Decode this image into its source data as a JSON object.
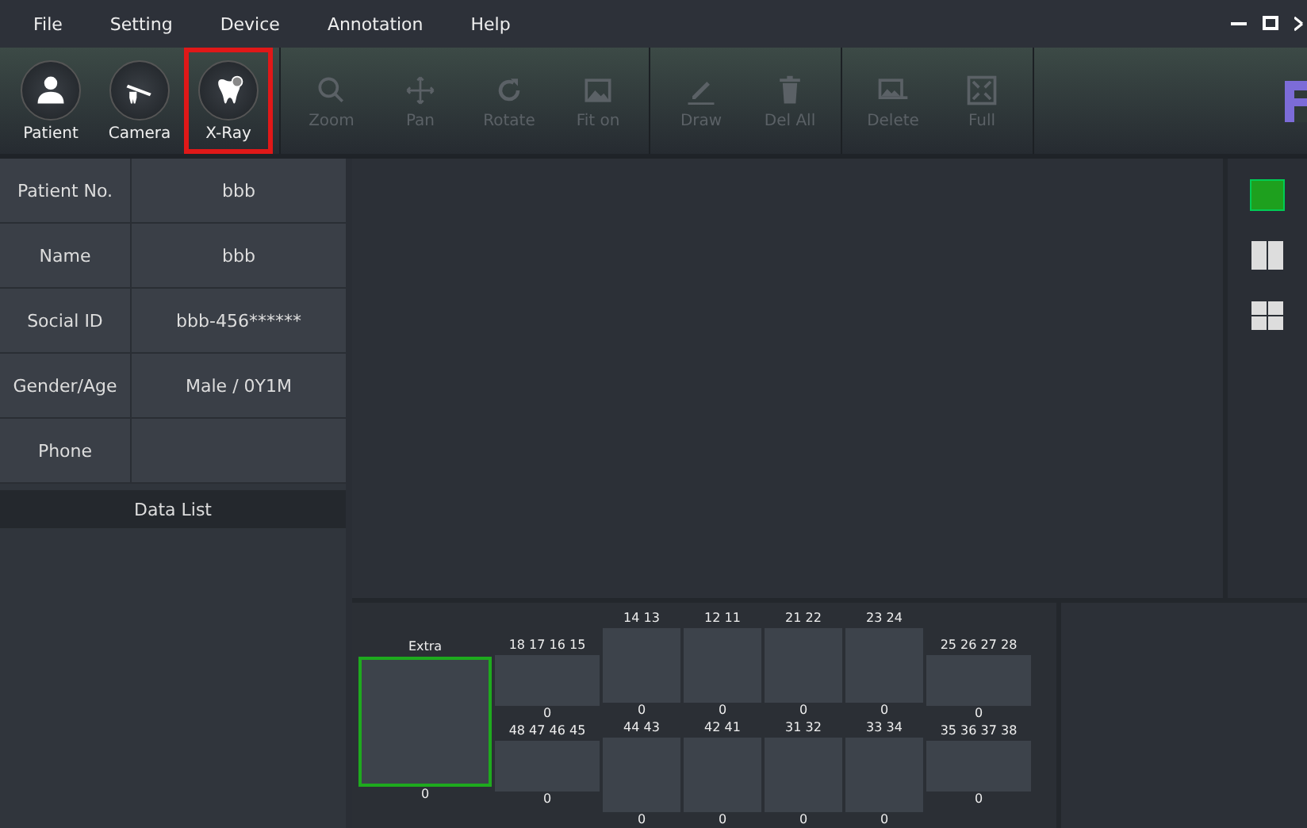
{
  "menu": [
    "File",
    "Setting",
    "Device",
    "Annotation",
    "Help"
  ],
  "toolbar": {
    "groups": [
      [
        {
          "label": "Patient",
          "kind": "person",
          "disabled": false,
          "highlighted": false
        },
        {
          "label": "Camera",
          "kind": "camera",
          "disabled": false,
          "highlighted": false
        },
        {
          "label": "X-Ray",
          "kind": "tooth",
          "disabled": false,
          "highlighted": true
        }
      ],
      [
        {
          "label": "Zoom",
          "kind": "zoom",
          "disabled": true,
          "highlighted": false
        },
        {
          "label": "Pan",
          "kind": "pan",
          "disabled": true,
          "highlighted": false
        },
        {
          "label": "Rotate",
          "kind": "rotate",
          "disabled": true,
          "highlighted": false
        },
        {
          "label": "Fit on",
          "kind": "fit",
          "disabled": true,
          "highlighted": false
        }
      ],
      [
        {
          "label": "Draw",
          "kind": "draw",
          "disabled": true,
          "highlighted": false
        },
        {
          "label": "Del All",
          "kind": "trash",
          "disabled": true,
          "highlighted": false
        }
      ],
      [
        {
          "label": "Delete",
          "kind": "image",
          "disabled": true,
          "highlighted": false
        },
        {
          "label": "Full",
          "kind": "full",
          "disabled": true,
          "highlighted": false
        }
      ]
    ]
  },
  "patient": [
    {
      "label": "Patient No.",
      "value": "bbb"
    },
    {
      "label": "Name",
      "value": "bbb"
    },
    {
      "label": "Social ID",
      "value": "bbb-456******"
    },
    {
      "label": "Gender/Age",
      "value": "Male / 0Y1M"
    },
    {
      "label": "Phone"
    }
  ],
  "data_list": {
    "title": "Data List"
  },
  "layouts": [
    {
      "kind": "single",
      "selected": true
    },
    {
      "kind": "two",
      "selected": false
    },
    {
      "kind": "four",
      "selected": false
    }
  ],
  "tooth_chart": {
    "extra": {
      "label": "Extra",
      "count": "0",
      "selected": true
    },
    "columns": [
      {
        "kind": "side",
        "upper": {
          "label": "18 17 16 15",
          "count": "0"
        },
        "lower": {
          "label": "48 47 46 45",
          "count": "0"
        }
      },
      {
        "kind": "center",
        "upper": {
          "label": "14 13",
          "count": "0"
        },
        "lower": {
          "label": "44 43",
          "count": "0"
        }
      },
      {
        "kind": "center",
        "upper": {
          "label": "12 11",
          "count": "0"
        },
        "lower": {
          "label": "42 41",
          "count": "0"
        }
      },
      {
        "kind": "center",
        "upper": {
          "label": "21 22",
          "count": "0"
        },
        "lower": {
          "label": "31 32",
          "count": "0"
        }
      },
      {
        "kind": "center",
        "upper": {
          "label": "23 24",
          "count": "0"
        },
        "lower": {
          "label": "33 34",
          "count": "0"
        }
      },
      {
        "kind": "side",
        "upper": {
          "label": "25 26 27 28",
          "count": "0"
        },
        "lower": {
          "label": "35 36 37 38",
          "count": "0"
        }
      }
    ]
  }
}
